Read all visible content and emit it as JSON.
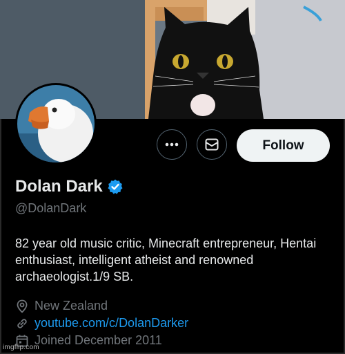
{
  "profile": {
    "display_name": "Dolan Dark",
    "verified_icon": "verified-badge-icon",
    "handle": "@DolanDark",
    "bio": "82 year old music critic, Minecraft entrepreneur, Hentai enthusiast, intelligent atheist and renowned archaeologist.1/9 SB.",
    "location": "New Zealand",
    "website": "youtube.com/c/DolanDarker",
    "joined": "Joined December 2011"
  },
  "actions": {
    "more_icon": "more-dots-icon",
    "message_icon": "envelope-icon",
    "follow_label": "Follow"
  },
  "icons": {
    "location": "location-pin-icon",
    "link": "link-icon",
    "calendar": "calendar-icon"
  },
  "colors": {
    "background": "#000000",
    "link": "#1d9bf0",
    "verified": "#1d9bf0",
    "secondary_text": "#71767b",
    "follow_button_bg": "#eff3f4"
  },
  "watermark": "imgflip.com"
}
